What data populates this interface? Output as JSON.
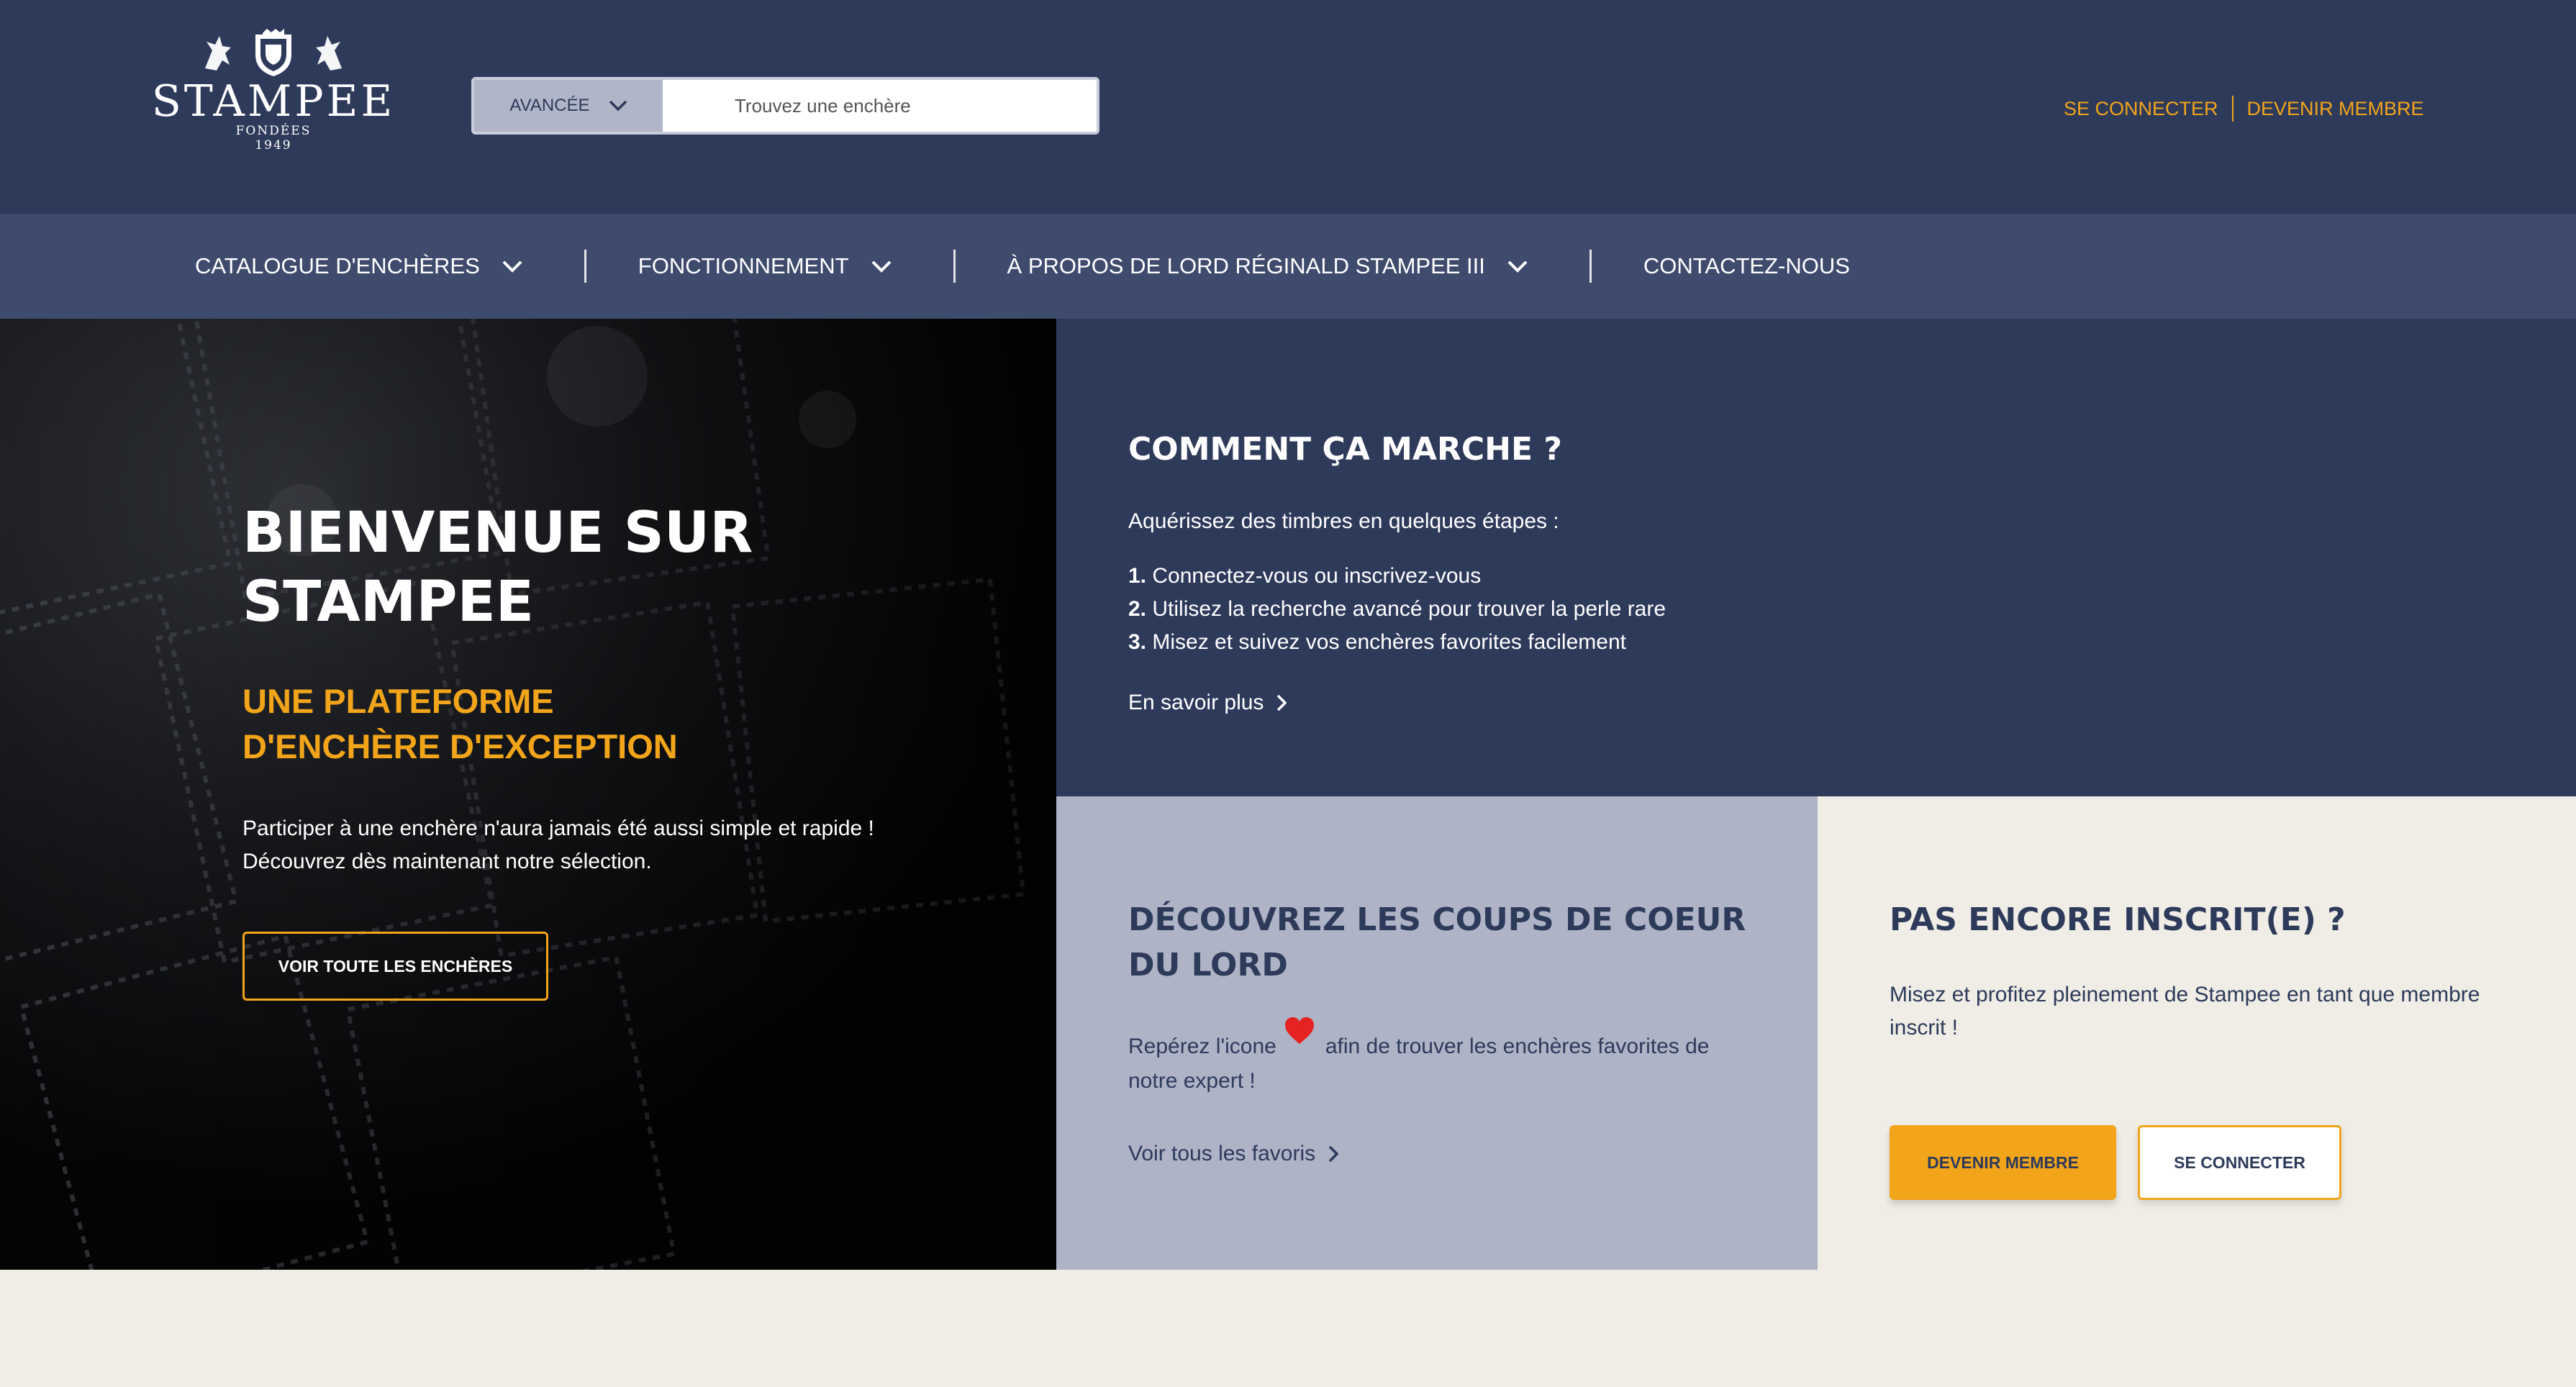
{
  "colors": {
    "navy": "#2d3a5a",
    "nav_bar": "#3e4b6d",
    "accent_orange": "#f2a51a",
    "lavender_gray": "#aeb3c6",
    "cream": "#efede6",
    "heart_red": "#e52323"
  },
  "logo": {
    "name": "STAMPEE",
    "founded_label": "FONDÉES",
    "founded_year": "1949",
    "icon": "crest-lions-icon"
  },
  "search": {
    "advanced_label": "AVANCÉE",
    "placeholder": "Trouvez une enchère"
  },
  "auth": {
    "login_label": "SE CONNECTER",
    "register_label": "DEVENIR MEMBRE"
  },
  "nav": {
    "items": [
      {
        "label": "CATALOGUE D'ENCHÈRES",
        "has_dropdown": true
      },
      {
        "label": "FONCTIONNEMENT",
        "has_dropdown": true
      },
      {
        "label": "À PROPOS DE LORD RÉGINALD STAMPEE III",
        "has_dropdown": true
      },
      {
        "label": "CONTACTEZ-NOUS",
        "has_dropdown": false
      }
    ]
  },
  "hero": {
    "title": "BIENVENUE SUR STAMPEE",
    "subtitle": "UNE PLATEFORME D'ENCHÈRE D'EXCEPTION",
    "text_line1": "Participer à une enchère n'aura jamais été aussi simple et rapide !",
    "text_line2": "Découvrez dès maintenant notre sélection.",
    "button_label": "VOIR TOUTE LES ENCHÈRES"
  },
  "how": {
    "title": "COMMENT ÇA MARCHE ?",
    "intro": "Aquérissez des timbres en quelques étapes :",
    "steps": [
      {
        "num": "1.",
        "text": " Connectez-vous ou inscrivez-vous"
      },
      {
        "num": "2.",
        "text": " Utilisez la recherche avancé pour trouver la perle rare"
      },
      {
        "num": "3.",
        "text": " Misez et suivez vos enchères favorites facilement"
      }
    ],
    "link_label": "En savoir plus"
  },
  "favorites": {
    "title": "DÉCOUVREZ LES COUPS DE COEUR DU LORD",
    "text_before_icon": "Repérez l'icone",
    "text_after_icon": "afin de trouver les enchères favorites de notre expert !",
    "link_label": "Voir tous les favoris"
  },
  "register": {
    "title": "PAS ENCORE INSCRIT(E) ?",
    "text": "Misez et profitez pleinement de Stampee en tant que membre inscrit !",
    "primary_label": "DEVENIR MEMBRE",
    "secondary_label": "SE CONNECTER"
  }
}
